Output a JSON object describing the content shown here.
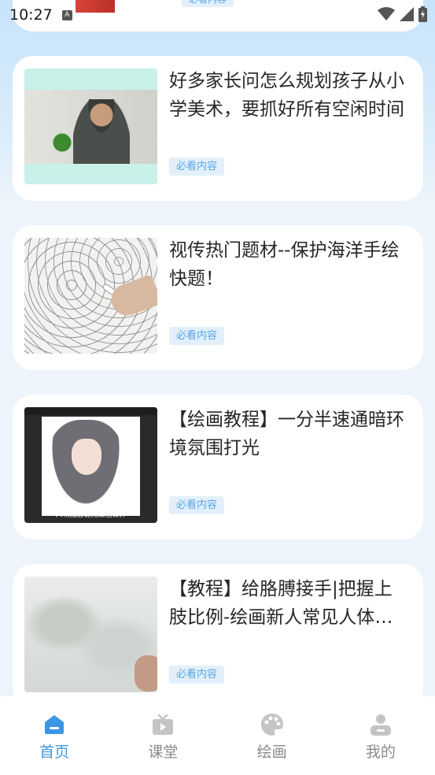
{
  "status_bar": {
    "time": "10:27",
    "a_indicator": "A"
  },
  "top_card_peek": {
    "tag": "必看内容"
  },
  "feed": [
    {
      "title": "好多家长问怎么规划孩子从小学美术，要抓好所有空闲时间",
      "tag": "必看内容",
      "thumb": "man-seated-photo"
    },
    {
      "title": "视传热门题材--保护海洋手绘快题！",
      "tag": "必看内容",
      "thumb": "line-drawing-sketch"
    },
    {
      "title": "【绘画教程】一分半速通暗环境氛围打光",
      "tag": "必看内容",
      "thumb": "anime-girl-illustration",
      "thumb_caption": "人物图层铺完底色合并"
    },
    {
      "title": "【教程】给胳膊接手|把握上肢比例-绘画新人常见人体问题",
      "tag": "必看内容",
      "thumb": "pencil-drawing-closeup"
    }
  ],
  "tabbar": {
    "items": [
      {
        "label": "首页",
        "icon": "home-icon",
        "active": true
      },
      {
        "label": "课堂",
        "icon": "tv-icon",
        "active": false
      },
      {
        "label": "绘画",
        "icon": "palette-icon",
        "active": false
      },
      {
        "label": "我的",
        "icon": "user-icon",
        "active": false
      }
    ]
  },
  "colors": {
    "accent": "#3d95e6",
    "tag_bg": "#e3f0fb",
    "tag_text": "#5aa6e6",
    "inactive": "#b8b8b8"
  }
}
